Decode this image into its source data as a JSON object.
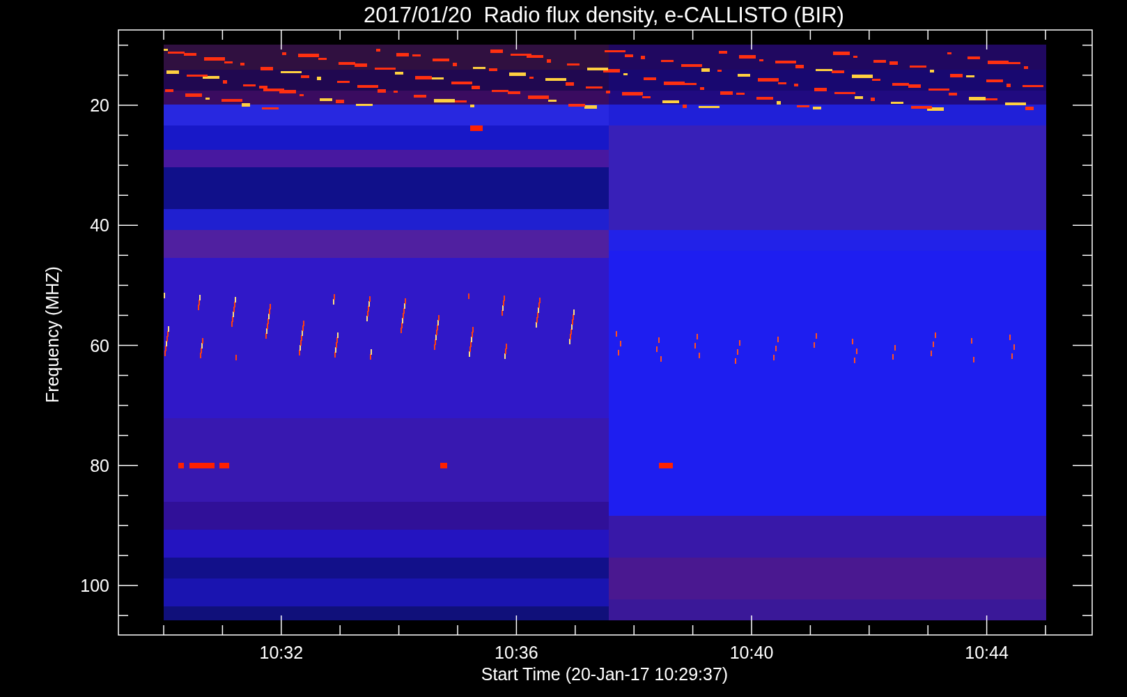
{
  "title": "2017/01/20  Radio flux density, e-CALLISTO (BIR)",
  "y_axis": {
    "label": "Frequency (MHZ)",
    "ticks": [
      "20",
      "40",
      "60",
      "80",
      "100"
    ]
  },
  "x_axis": {
    "label": "Start Time (20-Jan-17 10:29:37)",
    "ticks": [
      "10:32",
      "10:36",
      "10:40",
      "10:44"
    ]
  }
}
